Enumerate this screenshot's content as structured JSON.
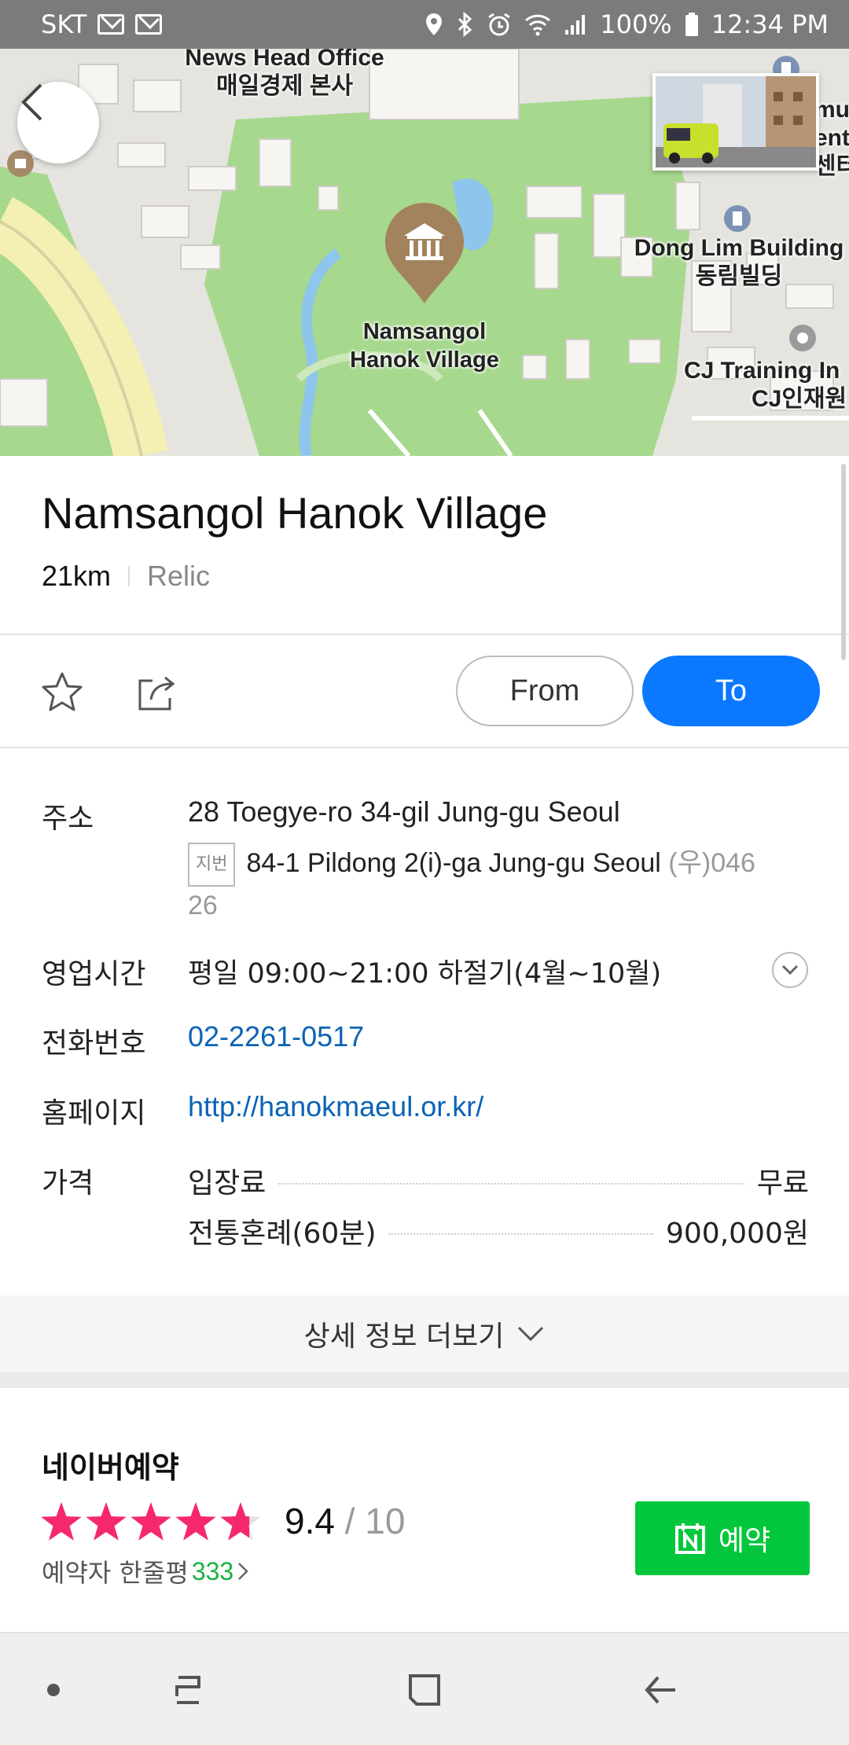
{
  "status_bar": {
    "carrier": "SKT",
    "battery": "100%",
    "time": "12:34 PM"
  },
  "map": {
    "labels": {
      "news_head_office_en": "News Head Office",
      "news_head_office_ko": "매일경제 본사",
      "dong_lim_en": "Dong Lim Building",
      "dong_lim_ko": "동림빌딩",
      "cj_training_en": "CJ Training In",
      "cj_training_ko": "CJ인재원",
      "hanok_line1": "Namsangol",
      "hanok_line2": "Hanok Village",
      "edge_top1": "mu",
      "edge_top2": "ent",
      "edge_top3": "센터"
    }
  },
  "place": {
    "name": "Namsangol Hanok Village",
    "distance": "21km",
    "category": "Relic"
  },
  "actions": {
    "from_label": "From",
    "to_label": "To"
  },
  "info": {
    "address_label": "주소",
    "address": "28 Toegye-ro 34-gil Jung-gu Seoul",
    "jibun_badge": "지번",
    "jibun_address": "84-1 Pildong 2(i)-ga Jung-gu Seoul",
    "postal_prefix": "(우)046",
    "postal_suffix": "26",
    "hours_label": "영업시간",
    "hours": "평일 09:00~21:00 하절기(4월~10월)",
    "phone_label": "전화번호",
    "phone": "02-2261-0517",
    "homepage_label": "홈페이지",
    "homepage": "http://hanokmaeul.or.kr/",
    "price_label": "가격",
    "prices": [
      {
        "item": "입장료",
        "price": "무료"
      },
      {
        "item": "전통혼례(60분)",
        "price": "900,000원"
      }
    ]
  },
  "more": {
    "label": "상세 정보 더보기"
  },
  "booking": {
    "title": "네이버예약",
    "rating": "9.4",
    "rating_max": "/ 10",
    "rating_value": 9.4,
    "review_prefix": "예약자 한줄평",
    "review_count": "333",
    "reserve_label": "예약"
  },
  "colors": {
    "primary_blue": "#0a78ff",
    "naver_green": "#02c73c",
    "star_pink": "#f5286e",
    "link_blue": "#0a63b5"
  }
}
